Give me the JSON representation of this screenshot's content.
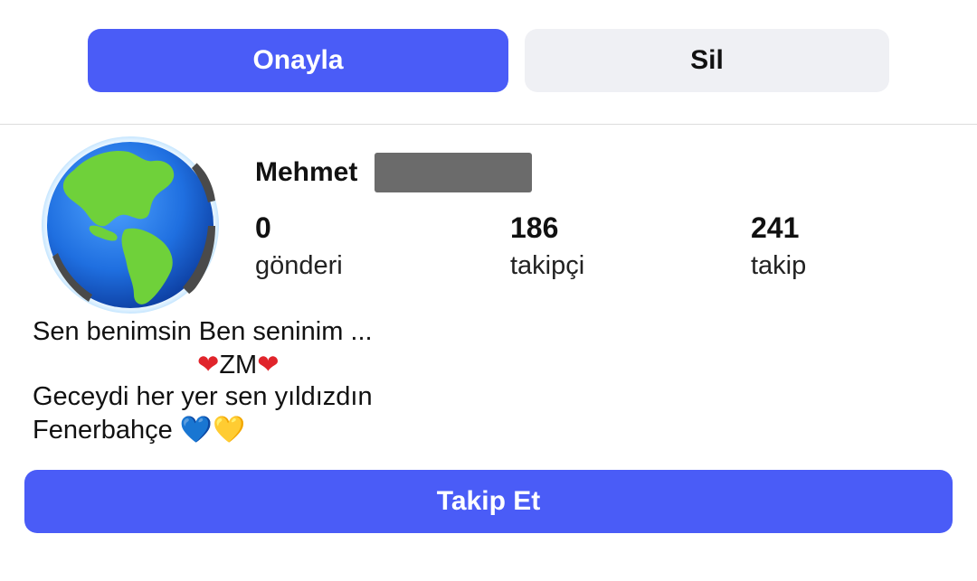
{
  "request": {
    "confirm_label": "Onayla",
    "delete_label": "Sil"
  },
  "profile": {
    "name": "Mehmet",
    "avatar_icon": "globe-icon",
    "stats": [
      {
        "value": "0",
        "label": "gönderi"
      },
      {
        "value": "186",
        "label": "takipçi"
      },
      {
        "value": "241",
        "label": "takip"
      }
    ],
    "bio": {
      "line1": "Sen benimsin Ben seninim ...",
      "line2_text": "ZM",
      "line3": "Geceydi her yer sen yıldızdın",
      "line4_text": "Fenerbahçe",
      "heart_red": "❤",
      "heart_blue": "💙",
      "heart_yellow": "💛"
    },
    "follow_label": "Takip Et"
  },
  "colors": {
    "accent": "#4a5cf7",
    "secondary_button": "#eff0f4",
    "redaction": "#6b6b6b"
  }
}
